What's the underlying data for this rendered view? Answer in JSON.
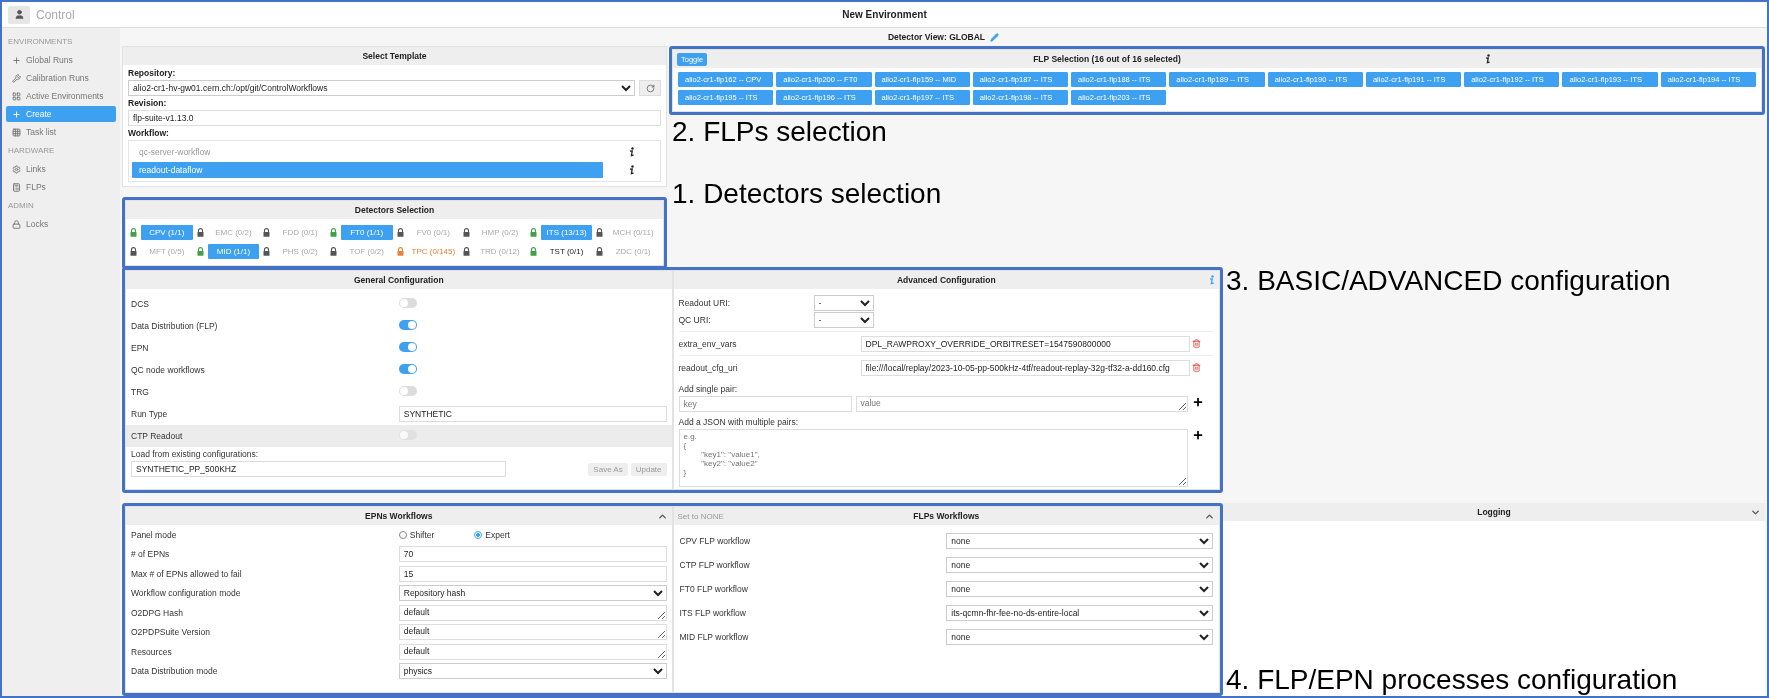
{
  "topbar": {
    "app_name": "Control",
    "title": "New Environment"
  },
  "sidebar": {
    "sections": [
      {
        "heading": "ENVIRONMENTS",
        "items": [
          {
            "label": "Global Runs",
            "selected": false
          },
          {
            "label": "Calibration Runs",
            "selected": false
          },
          {
            "label": "Active Environments",
            "selected": false
          },
          {
            "label": "Create",
            "selected": true
          },
          {
            "label": "Task list",
            "selected": false
          }
        ]
      },
      {
        "heading": "HARDWARE",
        "items": [
          {
            "label": "Links",
            "selected": false
          },
          {
            "label": "FLPs",
            "selected": false
          }
        ]
      },
      {
        "heading": "ADMIN",
        "items": [
          {
            "label": "Locks",
            "selected": false
          }
        ]
      }
    ]
  },
  "detector_view": {
    "label": "Detector View: GLOBAL"
  },
  "select_template": {
    "title": "Select Template",
    "repository": {
      "label": "Repository:",
      "value": "alio2-cr1-hv-gw01.cern.ch:/opt/git/ControlWorkflows"
    },
    "revision": {
      "label": "Revision:",
      "value": "flp-suite-v1.13.0"
    },
    "workflow": {
      "label": "Workflow:",
      "items": [
        {
          "label": "qc-server-workflow",
          "selected": false
        },
        {
          "label": "readout-dataflow",
          "selected": true
        }
      ]
    }
  },
  "detectors": {
    "title": "Detectors Selection",
    "items": [
      {
        "name": "CPV (1/1)",
        "color": "#43a047",
        "selected": true
      },
      {
        "name": "EMC (0/2)",
        "color": "#555555",
        "selected": false
      },
      {
        "name": "FDD (0/1)",
        "color": "#555555",
        "selected": false
      },
      {
        "name": "FT0 (1/1)",
        "color": "#43a047",
        "selected": true
      },
      {
        "name": "FV0 (0/1)",
        "color": "#555555",
        "selected": false
      },
      {
        "name": "HMP (0/2)",
        "color": "#555555",
        "selected": false
      },
      {
        "name": "ITS (13/13)",
        "color": "#43a047",
        "selected": true
      },
      {
        "name": "MCH (0/11)",
        "color": "#555555",
        "selected": false
      },
      {
        "name": "MFT (0/5)",
        "color": "#555555",
        "selected": false
      },
      {
        "name": "MID (1/1)",
        "color": "#43a047",
        "selected": true
      },
      {
        "name": "PHS (0/2)",
        "color": "#555555",
        "selected": false
      },
      {
        "name": "TOF (0/2)",
        "color": "#555555",
        "selected": false
      },
      {
        "name": "TPC (0/145)",
        "color": "#e8833a",
        "selected": false
      },
      {
        "name": "TRD (0/12)",
        "color": "#555555",
        "selected": false
      },
      {
        "name": "TST (0/1)",
        "color": "#43a047",
        "selected": false
      },
      {
        "name": "ZDC (0/1)",
        "color": "#555555",
        "selected": false
      }
    ]
  },
  "flp_selection": {
    "toggle": "Toggle",
    "title": "FLP Selection (16 out of 16 selected)",
    "items": [
      {
        "label": "alio2-cr1-flp162 -- CPV",
        "selected": true
      },
      {
        "label": "alio2-cr1-flp200 -- FT0",
        "selected": true
      },
      {
        "label": "alio2-cr1-flp159 -- MID",
        "selected": true
      },
      {
        "label": "alio2-cr1-flp187 -- ITS",
        "selected": true
      },
      {
        "label": "alio2-cr1-flp188 -- ITS",
        "selected": true
      },
      {
        "label": "alio2-cr1-flp189 -- ITS",
        "selected": true
      },
      {
        "label": "alio2-cr1-flp190 -- ITS",
        "selected": true
      },
      {
        "label": "alio2-cr1-flp191 -- ITS",
        "selected": true
      },
      {
        "label": "alio2-cr1-flp192 -- ITS",
        "selected": true
      },
      {
        "label": "alio2-cr1-flp193 -- ITS",
        "selected": true
      },
      {
        "label": "alio2-cr1-flp194 -- ITS",
        "selected": true
      },
      {
        "label": "alio2-cr1-flp195 -- ITS",
        "selected": true
      },
      {
        "label": "alio2-cr1-flp196 -- ITS",
        "selected": true
      },
      {
        "label": "alio2-cr1-flp197 -- ITS",
        "selected": true
      },
      {
        "label": "alio2-cr1-flp198 -- ITS",
        "selected": true
      },
      {
        "label": "alio2-cr1-flp203 -- ITS",
        "selected": true
      }
    ]
  },
  "general_config": {
    "title": "General Configuration",
    "rows": [
      {
        "kind": "toggle",
        "label": "DCS",
        "on": false,
        "disabled": false
      },
      {
        "kind": "toggle",
        "label": "Data Distribution (FLP)",
        "on": true,
        "disabled": false
      },
      {
        "kind": "toggle",
        "label": "EPN",
        "on": true,
        "disabled": false
      },
      {
        "kind": "toggle",
        "label": "QC node workflows",
        "on": true,
        "disabled": false
      },
      {
        "kind": "toggle",
        "label": "TRG",
        "on": false,
        "disabled": false
      },
      {
        "kind": "text",
        "label": "Run Type",
        "value": "SYNTHETIC",
        "disabled": false
      },
      {
        "kind": "toggle",
        "label": "CTP Readout",
        "on": false,
        "disabled": true
      }
    ],
    "load": {
      "label": "Load from existing configurations:",
      "value": "SYNTHETIC_PP_500KHZ",
      "buttons": [
        {
          "label": "Save As",
          "disabled": true
        },
        {
          "label": "Update",
          "disabled": true
        }
      ]
    }
  },
  "advanced_config": {
    "title": "Advanced Configuration",
    "uris": [
      {
        "label": "Readout URI:",
        "value": "-"
      },
      {
        "label": "QC URI:",
        "value": "-"
      }
    ],
    "vars": [
      {
        "key": "extra_env_vars",
        "value": "DPL_RAWPROXY_OVERRIDE_ORBITRESET=1547590800000"
      },
      {
        "key": "readout_cfg_uri",
        "value": "file:///local/replay/2023-10-05-pp-500kHz-4tf/readout-replay-32g-tf32-a-dd160.cfg"
      }
    ],
    "single_pair": {
      "label": "Add single pair:",
      "key_placeholder": "key",
      "value_placeholder": "value"
    },
    "json_pairs": {
      "label": "Add a JSON with multiple pairs:",
      "placeholder": "e.g.\n{\n        \"key1\": \"value1\",\n        \"key2\": \"value2\"\n}"
    }
  },
  "epn_workflows": {
    "title": "EPNs Workflows",
    "expanded": true,
    "panel_mode": {
      "label": "Panel mode",
      "options": [
        {
          "label": "Shifter",
          "selected": false
        },
        {
          "label": "Expert",
          "selected": true
        }
      ]
    },
    "fields": [
      {
        "kind": "input",
        "label": "# of EPNs",
        "value": "70"
      },
      {
        "kind": "input",
        "label": "Max # of EPNs allowed to fail",
        "value": "15"
      },
      {
        "kind": "select",
        "label": "Workflow configuration mode",
        "value": "Repository hash"
      },
      {
        "kind": "textarea",
        "label": "O2DPG Hash",
        "value": "default"
      },
      {
        "kind": "textarea",
        "label": "O2PDPSuite Version",
        "value": "default"
      },
      {
        "kind": "textarea",
        "label": "Resources",
        "value": "default"
      },
      {
        "kind": "select",
        "label": "Data Distribution mode",
        "value": "physics"
      }
    ]
  },
  "flp_workflows": {
    "set_none": "Set to NONE",
    "title": "FLPs Workflows",
    "expanded": true,
    "rows": [
      {
        "label": "CPV FLP workflow",
        "value": "none"
      },
      {
        "label": "CTP FLP workflow",
        "value": "none"
      },
      {
        "label": "FT0 FLP workflow",
        "value": "none"
      },
      {
        "label": "ITS FLP workflow",
        "value": "its-qcmn-fhr-fee-no-ds-entire-local"
      },
      {
        "label": "MID FLP workflow",
        "value": "none"
      }
    ]
  },
  "logging": {
    "title": "Logging",
    "expanded": false
  },
  "annotations": {
    "detectors": "1. Detectors selection",
    "flps": "2. FLPs selection",
    "config": "3. BASIC/ADVANCED configuration",
    "processes": "4. FLP/EPN processes configuration"
  }
}
